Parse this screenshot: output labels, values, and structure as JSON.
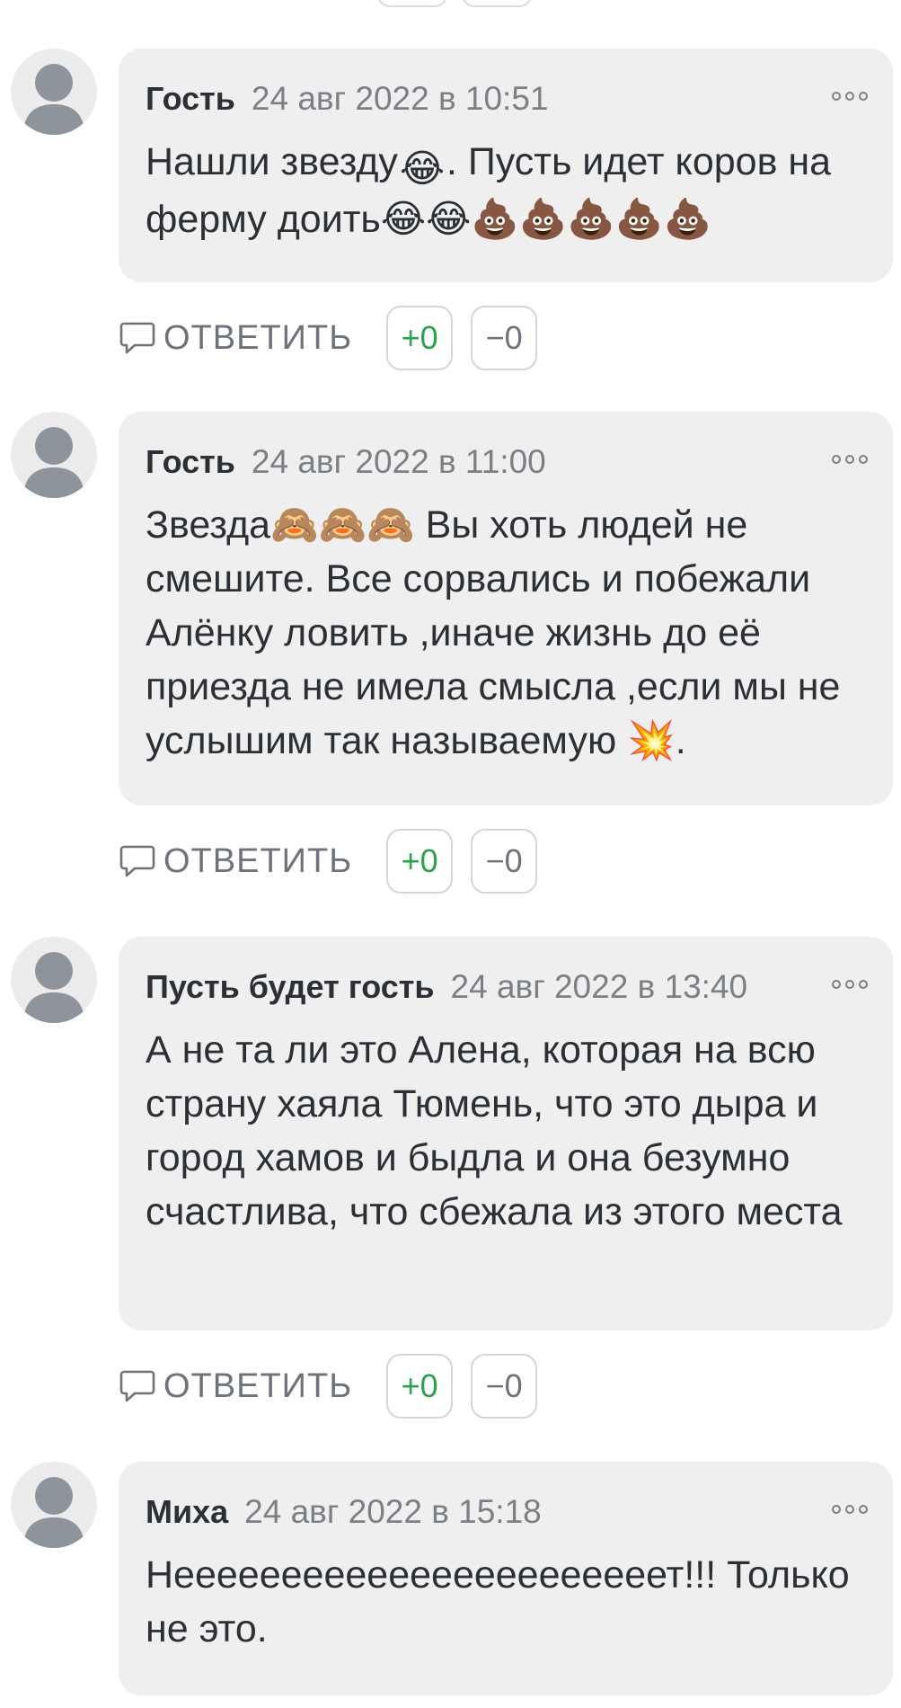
{
  "reply_label": "ОТВЕТИТЬ",
  "colors": {
    "bubble": "#efefef",
    "upvote": "#2ba24c",
    "muted": "#7b7f86"
  },
  "comments": [
    {
      "author": "Гость",
      "date": "24 авг 2022 в 10:51",
      "text_parts": [
        "Нашли звезду",
        "😂",
        ". Пусть идет коров на ферму доить",
        "😂😂💩💩💩💩💩"
      ],
      "upvotes": "+0",
      "downvotes": "−0"
    },
    {
      "author": "Гость",
      "date": "24 авг 2022 в 11:00",
      "text_parts": [
        "Звезда",
        "🙈🙈🙈",
        " Вы хоть людей не смешите. Все сорвались и побежали Алёнку ловить ,иначе жизнь до её приезда не имела смысла ,если мы не услышим так называемую ",
        "💥",
        "."
      ],
      "upvotes": "+0",
      "downvotes": "−0"
    },
    {
      "author": "Пусть будет гость",
      "date": "24 авг 2022 в 13:40",
      "text_parts": [
        "А не та ли это Алена, которая на всю страну хаяла Тюмень, что это дыра и город хамов и быдла и она безумно счастлива, что сбежала из этого места"
      ],
      "upvotes": "+0",
      "downvotes": "−0"
    },
    {
      "author": "Миха",
      "date": "24 авг 2022 в 15:18",
      "text_parts": [
        "Нееееееееееееееееееееееет!!! Только не это."
      ]
    }
  ]
}
